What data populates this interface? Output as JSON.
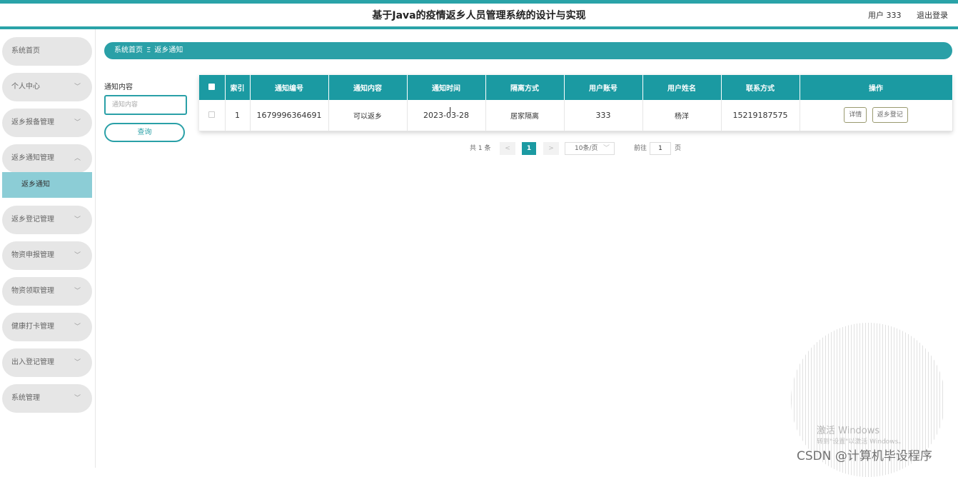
{
  "header": {
    "title": "基于Java的疫情返乡人员管理系统的设计与实现",
    "user": "用户 333",
    "logout": "退出登录"
  },
  "sidebar": {
    "items": [
      {
        "label": "系统首页"
      },
      {
        "label": "个人中心"
      },
      {
        "label": "返乡报备管理"
      },
      {
        "label": "返乡通知管理",
        "sub": "返乡通知"
      },
      {
        "label": "返乡登记管理"
      },
      {
        "label": "物资申报管理"
      },
      {
        "label": "物资领取管理"
      },
      {
        "label": "健康打卡管理"
      },
      {
        "label": "出入登记管理"
      },
      {
        "label": "系统管理"
      }
    ]
  },
  "breadcrumb": {
    "home": "系统首页",
    "current": "返乡通知"
  },
  "search": {
    "label": "通知内容",
    "placeholder": "通知内容",
    "button": "查询"
  },
  "table": {
    "columns": [
      "索引",
      "通知编号",
      "通知内容",
      "通知时间",
      "隔离方式",
      "用户账号",
      "用户姓名",
      "联系方式",
      "操作"
    ],
    "rows": [
      {
        "index": "1",
        "notice_no": "1679996364691",
        "content": "可以返乡",
        "time": "2023-03-28",
        "isolation": "居家隔离",
        "account": "333",
        "name": "杨洋",
        "phone": "15219187575",
        "actions": [
          "详情",
          "返乡登记"
        ]
      }
    ]
  },
  "pagination": {
    "total": "共 1 条",
    "prev": "<",
    "current": "1",
    "next": ">",
    "page_size": "10条/页",
    "goto_label": "前往",
    "goto_value": "1",
    "page_suffix": "页"
  },
  "watermark": {
    "windows_line1": "激活 Windows",
    "windows_line2": "转到\"设置\"以激活 Windows。",
    "csdn": "CSDN @计算机毕设程序"
  }
}
